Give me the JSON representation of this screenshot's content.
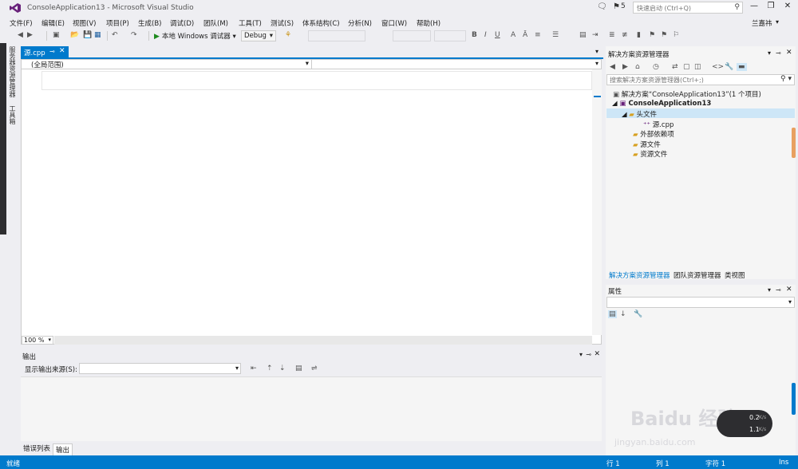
{
  "window": {
    "title": "ConsoleApplication13 - Microsoft Visual Studio",
    "notification_count": "5",
    "quick_launch_placeholder": "快速启动 (Ctrl+Q)"
  },
  "menu": [
    "文件(F)",
    "编辑(E)",
    "视图(V)",
    "项目(P)",
    "生成(B)",
    "调试(D)",
    "团队(M)",
    "工具(T)",
    "测试(S)",
    "体系结构(C)",
    "分析(N)",
    "窗口(W)",
    "帮助(H)"
  ],
  "user": "兰嘉祎",
  "toolbar": {
    "run_label": "本地 Windows 调试器",
    "config": "Debug"
  },
  "side_tabs": [
    "服务器资源管理器",
    "工具箱"
  ],
  "editor": {
    "tab_label": "源.cpp",
    "scope": "(全局范围)",
    "zoom": "100 %"
  },
  "output": {
    "title": "输出",
    "source_label": "显示输出来源(S):"
  },
  "bottom_tabs": [
    "错误列表",
    "输出"
  ],
  "solution_explorer": {
    "title": "解决方案资源管理器",
    "search_placeholder": "搜索解决方案资源管理器(Ctrl+;)",
    "tree": [
      {
        "label": "解决方案“ConsoleApplication13”(1 个项目)"
      },
      {
        "label": "ConsoleApplication13"
      },
      {
        "label": "头文件"
      },
      {
        "label": "源.cpp"
      },
      {
        "label": "外部依赖项"
      },
      {
        "label": "源文件"
      },
      {
        "label": "资源文件"
      }
    ],
    "tabs": [
      "解决方案资源管理器",
      "团队资源管理器",
      "类视图"
    ]
  },
  "properties": {
    "title": "属性"
  },
  "status": {
    "left": "就绪",
    "line": "行 1",
    "col": "列 1",
    "char": "字符 1",
    "mode": "Ins"
  },
  "overlay": {
    "watermark": "Baidu 经验",
    "watermark_url": "jingyan.baidu.com",
    "net_up": "0.2",
    "net_down": "1.1",
    "net_unit": "K/s"
  },
  "colors": {
    "accent": "#007acc",
    "chrome": "#eeeef2",
    "run_green": "#1e8a1e"
  }
}
